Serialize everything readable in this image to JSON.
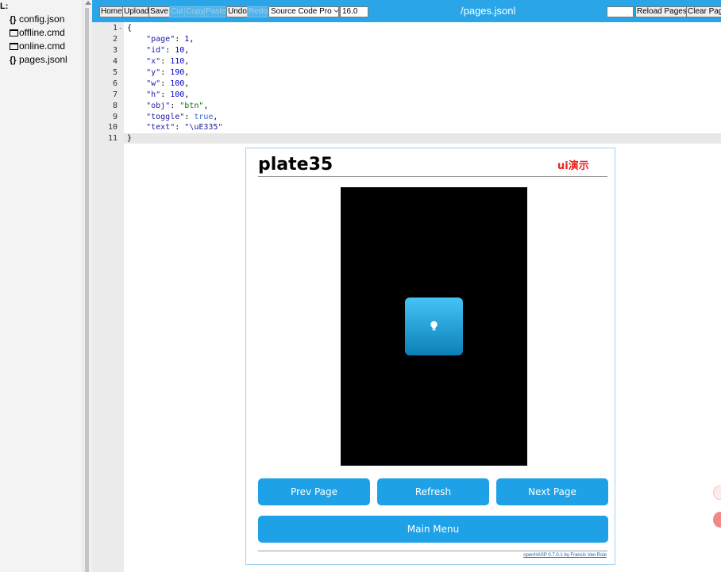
{
  "file_tree": {
    "header": "L:",
    "items": [
      {
        "icon": "json-file-icon",
        "glyph": "{}",
        "label": "config.json"
      },
      {
        "icon": "cmd-file-icon",
        "glyph": "",
        "label": "offline.cmd"
      },
      {
        "icon": "cmd-file-icon",
        "glyph": "",
        "label": "online.cmd"
      },
      {
        "icon": "json-file-icon",
        "glyph": "{}",
        "label": "pages.jsonl"
      }
    ]
  },
  "toolbar": {
    "buttons": [
      "Home",
      "Upload",
      "Save",
      "Cut",
      "Copy",
      "Paste",
      "Undo",
      "Redo"
    ],
    "disabled": [
      "Cut",
      "Copy",
      "Paste",
      "Redo"
    ],
    "font_select": "Source Code Pro",
    "font_size": "16.0",
    "file_title": "/pages.jsonl",
    "search_value": "",
    "reload_label": "Reload Pages",
    "clear_label": "Clear Pag"
  },
  "editor": {
    "lines": [
      {
        "n": "1",
        "fold": "-",
        "text": "{"
      },
      {
        "n": "2",
        "key": "page",
        "val": "1",
        "kind": "num"
      },
      {
        "n": "3",
        "key": "id",
        "val": "10",
        "kind": "num"
      },
      {
        "n": "4",
        "key": "x",
        "val": "110",
        "kind": "num"
      },
      {
        "n": "5",
        "key": "y",
        "val": "190",
        "kind": "num"
      },
      {
        "n": "6",
        "key": "w",
        "val": "100",
        "kind": "num"
      },
      {
        "n": "7",
        "key": "h",
        "val": "100",
        "kind": "num"
      },
      {
        "n": "8",
        "key": "obj",
        "val": "\"btn\"",
        "kind": "str"
      },
      {
        "n": "9",
        "key": "toggle",
        "val": "true",
        "kind": "bool"
      },
      {
        "n": "10",
        "key": "text",
        "val": "\"\\uE335\"",
        "kind": "esc",
        "last": true
      },
      {
        "n": "11",
        "text": "}"
      }
    ]
  },
  "preview": {
    "title": "plate35",
    "subtitle": "ui演示",
    "screen_button_icon": "lightbulb-icon",
    "buttons": {
      "prev": "Prev Page",
      "refresh": "Refresh",
      "next": "Next Page",
      "main_menu": "Main Menu"
    },
    "credit": "openHASP 0.7.0.1 by Francis Van Roie"
  },
  "colors": {
    "toolbar": "#2aa6e8",
    "button": "#1ea1e6",
    "subtitle": "#e8231e"
  }
}
